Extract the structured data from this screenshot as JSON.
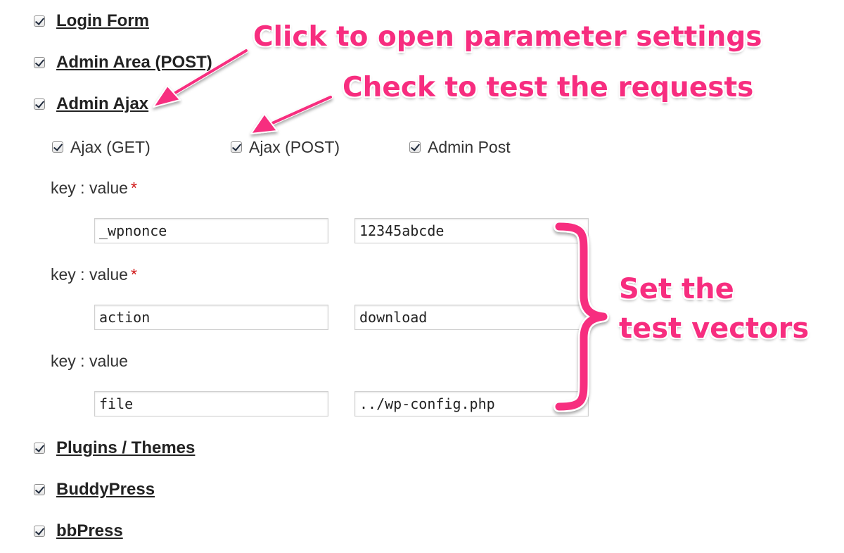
{
  "sections": {
    "login_form": {
      "label": "Login Form",
      "checked": true
    },
    "admin_area": {
      "label": "Admin Area (POST)",
      "checked": true
    },
    "admin_ajax": {
      "label": "Admin Ajax",
      "checked": true
    },
    "plugins_themes": {
      "label": "Plugins / Themes",
      "checked": true
    },
    "buddypress": {
      "label": "BuddyPress",
      "checked": true
    },
    "bbpress": {
      "label": "bbPress",
      "checked": true
    }
  },
  "ajax_options": {
    "ajax_get": {
      "label": "Ajax (GET)",
      "checked": true
    },
    "ajax_post": {
      "label": "Ajax (POST)",
      "checked": true
    },
    "admin_post": {
      "label": "Admin Post",
      "checked": true
    }
  },
  "params": [
    {
      "label": "key : value",
      "required_mark": "*",
      "key": "_wpnonce",
      "value": "12345abcde"
    },
    {
      "label": "key : value",
      "required_mark": "*",
      "key": "action",
      "value": "download"
    },
    {
      "label": "key : value",
      "required_mark": "",
      "key": "file",
      "value": "../wp-config.php"
    }
  ],
  "annotations": {
    "open_settings": "Click to open parameter settings",
    "check_requests": "Check to test the requests",
    "set_vectors_line1": "Set the",
    "set_vectors_line2": "test vectors",
    "color": "#f72d7f"
  }
}
